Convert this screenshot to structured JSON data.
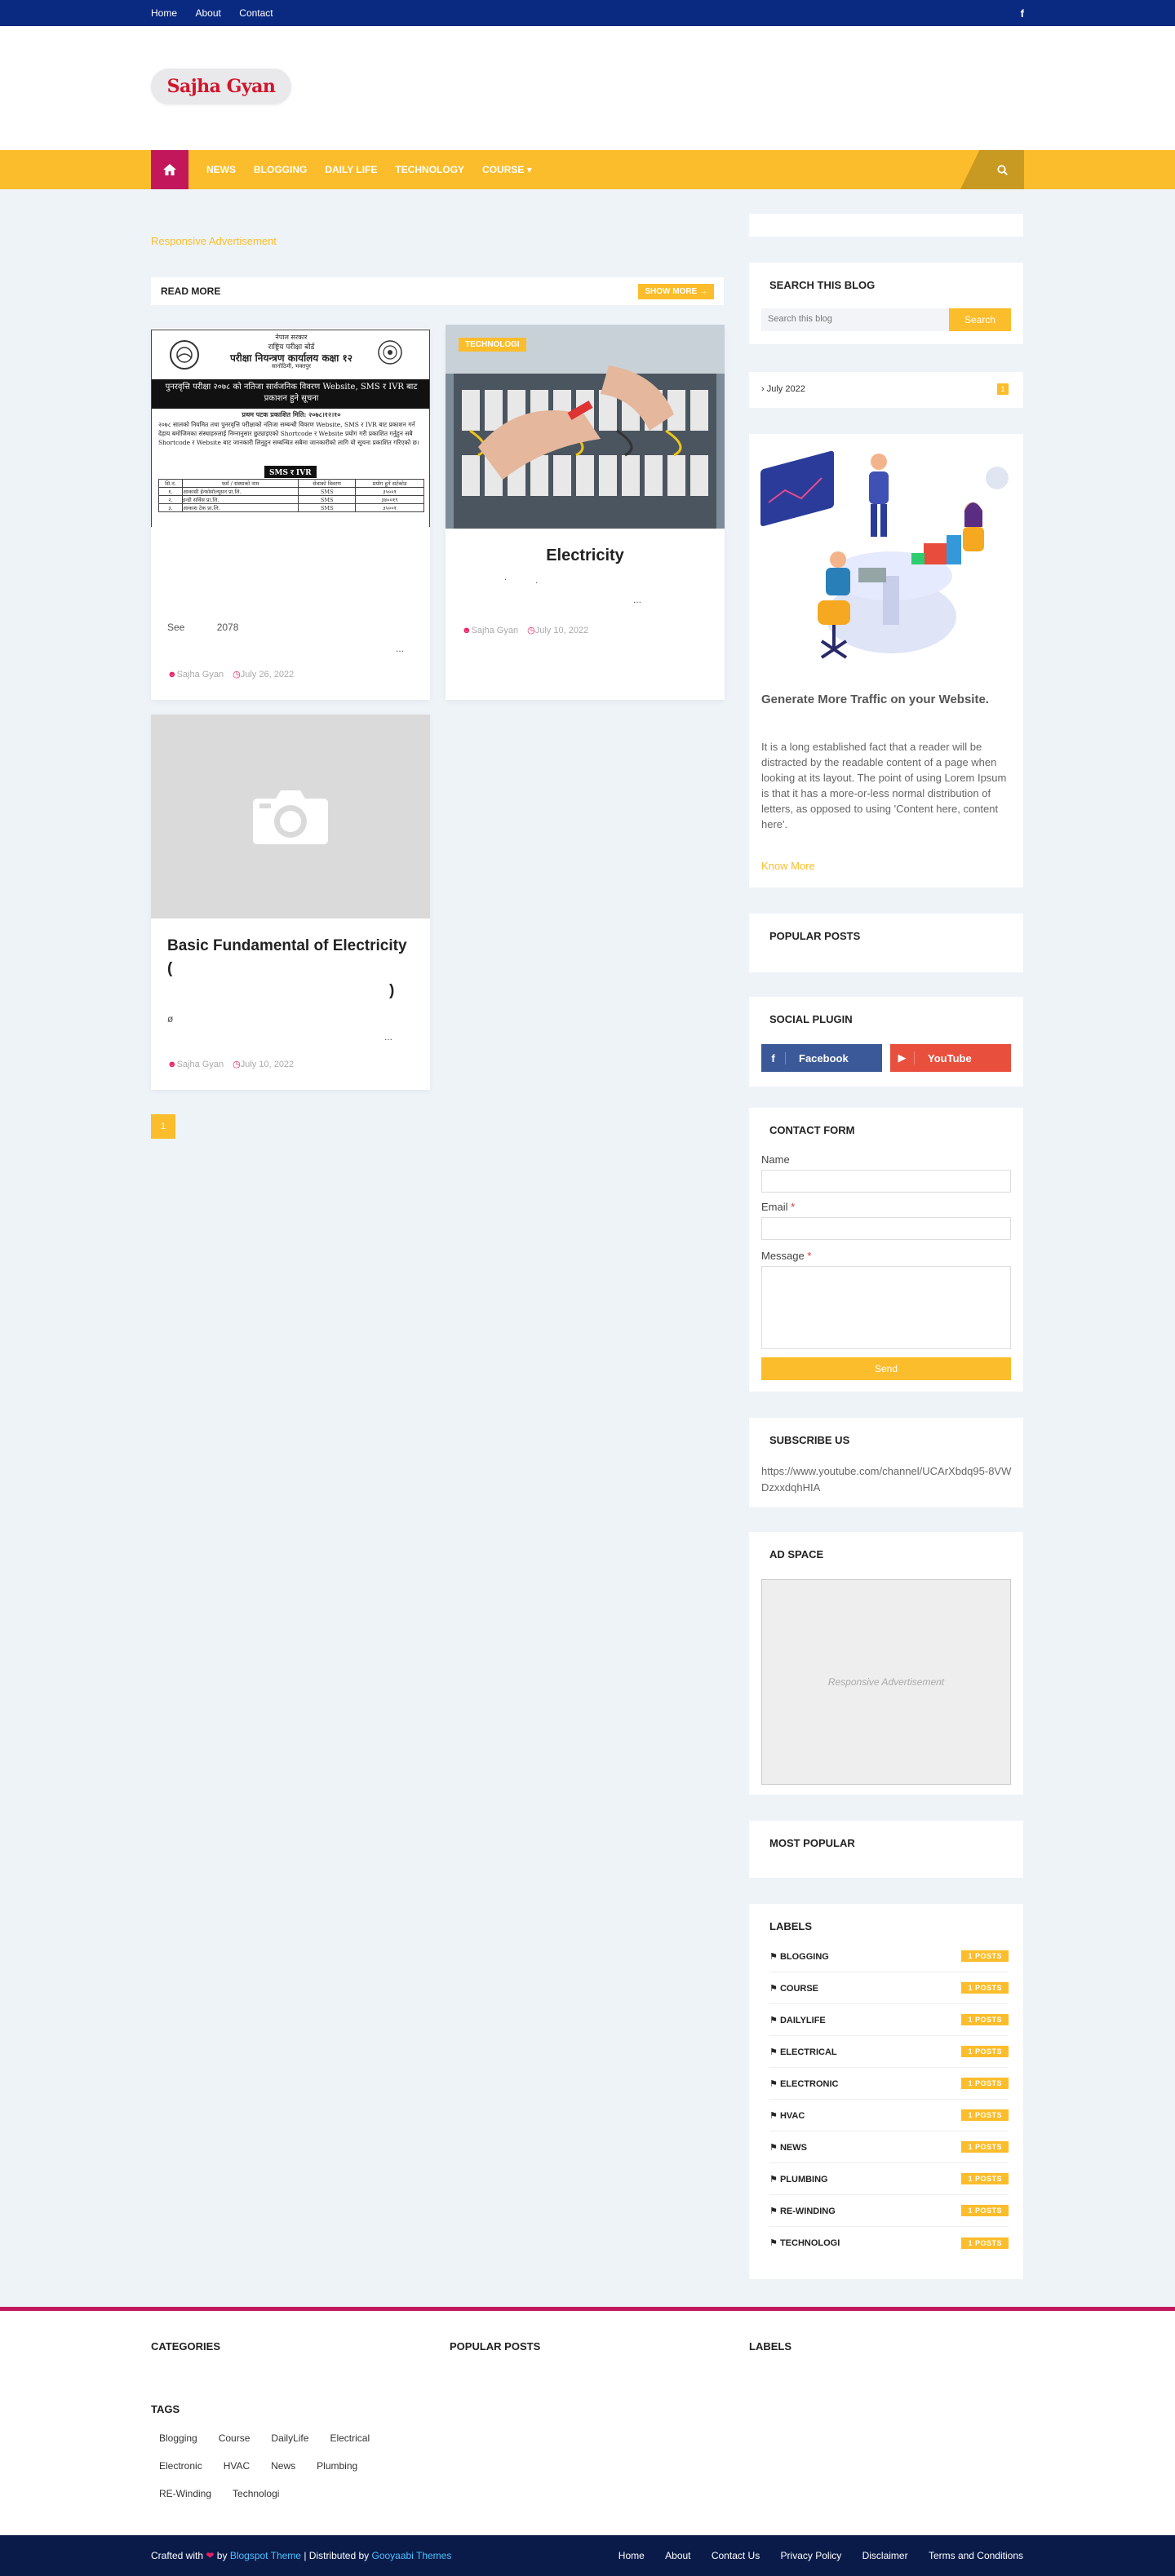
{
  "topbar": {
    "links": [
      "Home",
      "About",
      "Contact"
    ],
    "social": "f"
  },
  "logo": {
    "text": "Sajha Gyan"
  },
  "nav": {
    "items": [
      "NEWS",
      "BLOGGING",
      "DAILY LIFE",
      "TECHNOLOGY",
      "COURSE"
    ]
  },
  "main": {
    "ad_text": "Responsive Advertisement",
    "read_more": "READ MORE",
    "show_more": "SHOW MORE",
    "posts": [
      {
        "title": "",
        "excerpt_a": "See",
        "excerpt_b": "2078",
        "ellipsis": "...",
        "author": "Sajha Gyan",
        "date": "July 26, 2022"
      },
      {
        "tag": "TECHNOLOGI",
        "title": "Electricity",
        "dots": ".",
        "ellipsis": "...",
        "author": "Sajha Gyan",
        "date": "July 10, 2022"
      },
      {
        "title": "Basic Fundamental of Electricity (",
        "title_end": ")",
        "excerpt": "ø",
        "ellipsis": "...",
        "author": "Sajha Gyan",
        "date": "July 10, 2022"
      }
    ],
    "page": "1"
  },
  "notice": {
    "l1": "नेपाल सरकार",
    "l2": "राष्ट्रिय परीक्षा बोर्ड",
    "l3": "परीक्षा नियन्त्रण कार्यालय कक्षा १२",
    "l4": "सानोठिमी, भक्तपुर",
    "banner": "पुनरवृत्ति परीक्षा २०७८ को नतिजा सार्वजनिक विवरण Website, SMS र IVR बाट प्रकाशन हुने सूचना",
    "sub": "प्रथम पटक प्रकाशित मिति: २०७८।१२।१०",
    "body": "२०७८ सालको नियमित तथा पुनरवृत्ति परीक्षाको नतिजा सम्बन्धी विवरण Website, SMS र IVR बाट प्रकाशन गर्न देहाय बमोजिमका संस्थाहरुलाई निम्नानुसार छुट्याइएको Shortcode र Website प्रयोग गरी प्रकाशित गर्नुहुन सबै Shortcode र Website बाट जानकारी लिनुहुन सम्बन्धित सबैमा जानकारीको लागि यो सूचना प्रकाशित गरिएको छ।",
    "chip": "SMS र IVR",
    "headers": [
      "सि.नं.",
      "फर्म / संस्थाको नाम",
      "सेवाको विवरण",
      "प्रयोग हुने सर्टकोड"
    ],
    "rows": [
      [
        "१.",
        "आकासी ईन्फोसोल्यूसन प्रा.लि.",
        "SMS",
        "३५००१"
      ],
      [
        "२.",
        "इन्डी सर्विस प्रा.लि.",
        "SMS",
        "३४००१९"
      ],
      [
        "३.",
        "आकाश टेक प्रा.लि.",
        "SMS",
        "३५००१"
      ]
    ]
  },
  "sidebar": {
    "search_title": "SEARCH THIS BLOG",
    "search_placeholder": "Search this blog",
    "search_btn": "Search",
    "archive": "July 2022",
    "archive_count": "1",
    "promo_title": "Generate More Traffic on your Website.",
    "promo_text": "It is a long established fact that a reader will be distracted by the readable content of a page when looking at its layout. The point of using Lorem Ipsum is that it has a more-or-less normal distribution of letters, as opposed to using 'Content here, content here'.",
    "promo_link": "Know More",
    "popular_title": "POPULAR POSTS",
    "social_title": "SOCIAL PLUGIN",
    "facebook": "Facebook",
    "youtube": "YouTube",
    "contact_title": "CONTACT FORM",
    "name_label": "Name",
    "email_label": "Email",
    "message_label": "Message",
    "required": "*",
    "send": "Send",
    "subscribe_title": "SUBSCRIBE US",
    "subscribe_text": "https://www.youtube.com/channel/UCArXbdq95-8VWDzxxdqhHIA",
    "ad_title": "AD SPACE",
    "ad_text": "Responsive Advertisement",
    "most_popular": "MOST POPULAR",
    "labels_title": "LABELS",
    "labels": [
      {
        "name": "BLOGGING",
        "count": "1 POSTS"
      },
      {
        "name": "COURSE",
        "count": "1 POSTS"
      },
      {
        "name": "DAILYLIFE",
        "count": "1 POSTS"
      },
      {
        "name": "ELECTRICAL",
        "count": "1 POSTS"
      },
      {
        "name": "ELECTRONIC",
        "count": "1 POSTS"
      },
      {
        "name": "HVAC",
        "count": "1 POSTS"
      },
      {
        "name": "NEWS",
        "count": "1 POSTS"
      },
      {
        "name": "PLUMBING",
        "count": "1 POSTS"
      },
      {
        "name": "RE-WINDING",
        "count": "1 POSTS"
      },
      {
        "name": "TECHNOLOGI",
        "count": "1 POSTS"
      }
    ]
  },
  "footer": {
    "categories": "CATEGORIES",
    "popular": "POPULAR POSTS",
    "labels": "LABELS",
    "tags_title": "TAGS",
    "tags": [
      "Blogging",
      "Course",
      "DailyLife",
      "Electrical",
      "Electronic",
      "HVAC",
      "News",
      "Plumbing",
      "RE-Winding",
      "Technologi"
    ],
    "crafted": "Crafted with",
    "by": "by",
    "theme": "Blogspot Theme",
    "distributed": "| Distributed by",
    "gooyaabi": "Gooyaabi Themes",
    "links": [
      "Home",
      "About",
      "Contact Us",
      "Privacy Policy",
      "Disclaimer",
      "Terms and Conditions"
    ]
  }
}
